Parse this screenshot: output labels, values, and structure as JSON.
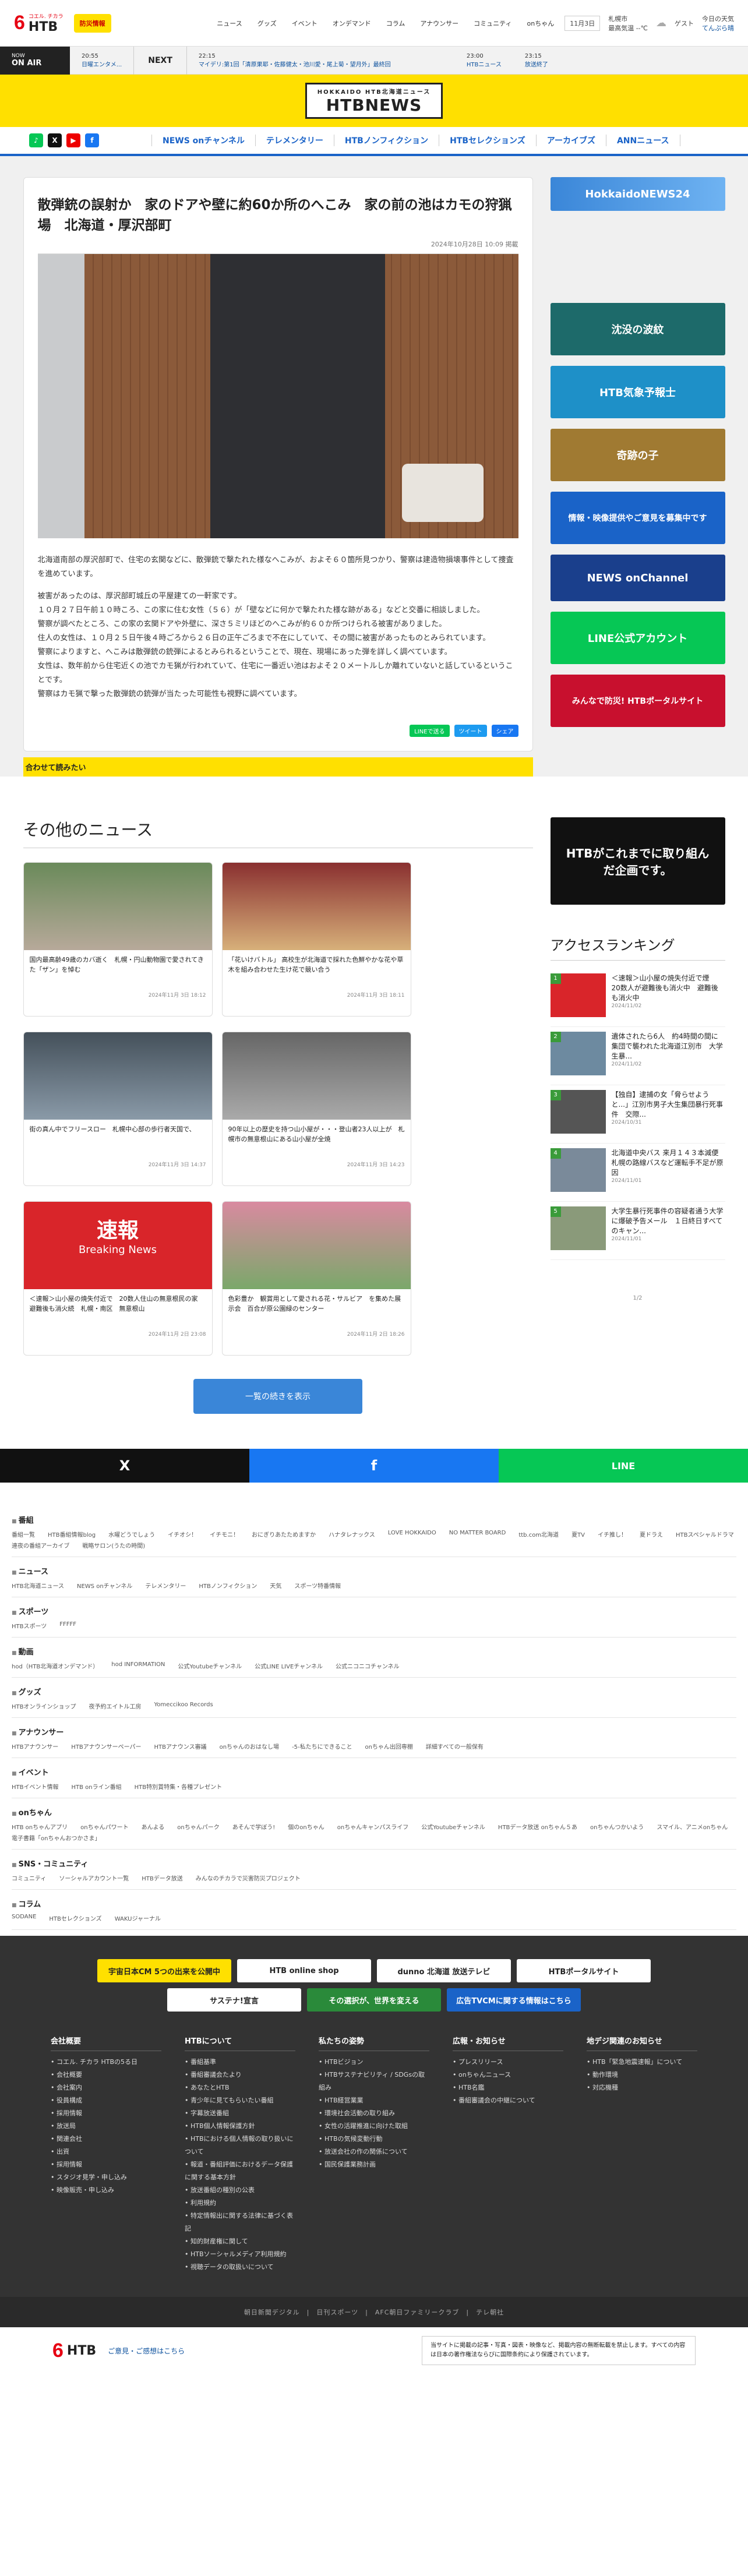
{
  "header": {
    "brand_six": "6",
    "brand_sub": "コエル. チカラ",
    "brand_htb": "HTB",
    "bosai": "防災情報",
    "nav": [
      "ニュース",
      "グッズ",
      "イベント",
      "オンデマンド",
      "コラム",
      "アナウンサー",
      "コミュニティ",
      "onちゃん"
    ],
    "date": "11月3日",
    "location": "札幌市",
    "weather_note": "最高気温 --℃",
    "today": "今日の天気",
    "today_val": "てんぷら晴",
    "user": "ゲスト"
  },
  "ticker": {
    "onair_sub": "NOW",
    "onair": "ON AIR",
    "now_time": "20:55",
    "now_prog": "日曜エンタメ...",
    "next": "NEXT",
    "items": [
      {
        "time": "22:15",
        "prog": "マイデリ:第1回「清原果耶・佐藤健太・池川愛・尾上菊・望月外」最終回"
      },
      {
        "time": "23:00",
        "prog": "HTBニュース"
      },
      {
        "time": "23:15",
        "prog": "放送終了"
      }
    ]
  },
  "masthead": {
    "top": "HOKKAIDO HTB北海道ニュース",
    "main": "HTBNEWS"
  },
  "nav": {
    "items": [
      "NEWS onチャンネル",
      "テレメンタリー",
      "HTBノンフィクション",
      "HTBセレクションズ",
      "アーカイブズ",
      "ANNニュース"
    ]
  },
  "article": {
    "title": "散弾銃の誤射か　家のドアや壁に約60か所のへこみ　家の前の池はカモの狩猟場　北海道・厚沢部町",
    "date": "2024年10月28日 10:09 掲載",
    "paragraphs": [
      "北海道南部の厚沢部町で、住宅の玄関などに、散弾銃で撃たれた様なへこみが、およそ６０箇所見つかり、警察は建造物損壊事件として捜査を進めています。",
      "被害があったのは、厚沢部町城丘の平屋建ての一軒家です。\n１０月２７日午前１０時ころ、この家に住む女性（５６）が「壁などに何かで撃たれた様な跡がある」などと交番に相談しました。\n警察が調べたところ、この家の玄関ドアや外壁に、深さ５ミリほどのへこみが約６０か所つけられる被害がありました。\n住人の女性は、１０月２５日午後４時ごろから２６日の正午ごろまで不在にしていて、その間に被害があったものとみられています。\n警察によりますと、へこみは散弾銃の銃弾によるとみられるということで、現在、現場にあった弾を詳しく調べています。\n女性は、数年前から住宅近くの池でカモ猟が行われていて、住宅に一番近い池はおよそ２０メートルしか離れていないと話しているということです。\n警察はカモ猟で撃った散弾銃の銃弾が当たった可能性も視野に調べています。"
    ],
    "share": [
      "LINEで送る",
      "ツイート",
      "シェア"
    ],
    "readtoo": "合わせて読みたい"
  },
  "sidebar": {
    "banners": [
      "HokkaidoNEWS24",
      "沈没の波紋",
      "HTB気象予報士",
      "奇跡の子",
      "情報・映像提供やご意見を募集中です",
      "NEWS onChannel",
      "LINE公式アカウント",
      "みんなで防災! HTBポータルサイト",
      "HTBがこれまでに取り組んだ企画です。"
    ]
  },
  "others": {
    "title": "その他のニュース",
    "cards": [
      {
        "t": "国内最高齢49歳のカバ逝く　札幌・円山動物園で愛されてきた「ザン」を悼む",
        "d": "2024年11月 3日 18:12"
      },
      {
        "t": "「花いけバトル」 高校生が北海道で採れた色鮮やかな花や草木を組み合わせた生け花で競い合う",
        "d": "2024年11月 3日 18:11"
      },
      {
        "t": "街の真ん中でフリースロー　札幌中心部の歩行者天国で、",
        "d": "2024年11月 3日 14:37"
      },
      {
        "t": "90年以上の歴史を持つ山小屋が・・・登山者23人以上が　札幌市の無意根山にある山小屋が全焼",
        "d": "2024年11月 3日 14:23"
      },
      {
        "t": "＜速報＞山小屋の焼失付近で　20数人住山の無意根民の家　避難後も消火続　札幌・南区　無意根山",
        "d": "2024年11月 2日 23:08"
      },
      {
        "t": "色彩豊か　観賞用として愛される花・サルビア　を集めた展示会　百合が原公園緑のセンター",
        "d": "2024年11月 2日 18:26"
      }
    ],
    "more": "一覧の続きを表示",
    "breaking_top": "速報",
    "breaking_bot": "Breaking News"
  },
  "ranking": {
    "title": "アクセスランキング",
    "items": [
      {
        "n": "1",
        "t": "＜速報＞山小屋の焼失付近で煙　20数人が避難後も消火中　避難後も消火中",
        "d": "2024/11/02"
      },
      {
        "n": "2",
        "t": "遺体されたら6人　約4時間の間に集団で襲われた北海道江別市　大学生暴...",
        "d": "2024/11/02"
      },
      {
        "n": "3",
        "t": "【独自】逮捕の女「脅らせようと...」江別市男子大生集団暴行死事件　交際...",
        "d": "2024/10/31"
      },
      {
        "n": "4",
        "t": "北海道中央バス 来月１４３本減便 札幌の路線バスなど運転手不足が原因",
        "d": "2024/11/01"
      },
      {
        "n": "5",
        "t": "大学生暴行死事件の容疑者通う大学に爆破予告メール　１日終日すべてのキャン...",
        "d": "2024/11/01"
      }
    ],
    "page": "1/2"
  },
  "sharebar": [
    "X",
    "f",
    "LINE"
  ],
  "sitemap": [
    {
      "t": "番組",
      "l": [
        "番組一覧",
        "HTB番組情報blog",
        "水曜どうでしょう",
        "イチオシ！",
        "イチモニ！",
        "おにぎりあたためますか",
        "ハナタレナックス",
        "LOVE HOKKAIDO",
        "NO MATTER BOARD",
        "ttb.com北海道",
        "夏TV",
        "イチ推し！",
        "夏ドラえ",
        "HTBスペシャルドラマ",
        "連夜の番組アーカイブ",
        "戦略サロン(うたの時間)"
      ]
    },
    {
      "t": "ニュース",
      "l": [
        "HTB北海道ニュース",
        "NEWS onチャンネル",
        "テレメンタリー",
        "HTBノンフィクション",
        "天気",
        "スポーツ特番情報"
      ]
    },
    {
      "t": "スポーツ",
      "l": [
        "HTBスポーツ",
        "FFFFF"
      ]
    },
    {
      "t": "動画",
      "l": [
        "hod（HTB北海道オンデマンド）",
        "hod INFORMATION",
        "公式Youtubeチャンネル",
        "公式LINE LIVEチャンネル",
        "公式ニコニコチャンネル"
      ]
    },
    {
      "t": "グッズ",
      "l": [
        "HTBオンラインショップ",
        "夜予約エイトル工房",
        "Yomeccikoo Records"
      ]
    },
    {
      "t": "アナウンサー",
      "l": [
        "HTBアナウンサー",
        "HTBアナウンサーペーパー",
        "HTBアナウンス審議",
        "onちゃんのおはなし場",
        "-5-私たちにできること",
        "onちゃん出回専棚",
        "詳細すべての一般保有"
      ]
    },
    {
      "t": "イベント",
      "l": [
        "HTBイベント情報",
        "HTB onライン番組",
        "HTB特別賞特集・各種プレゼント"
      ]
    },
    {
      "t": "onちゃん",
      "l": [
        "HTB onちゃんアプリ",
        "onちゃんパワート",
        "あんよる",
        "onちゃんパーク",
        "あそんで学ぼう!",
        "個のonちゃん",
        "onちゃんキャンパスライフ",
        "公式Youtubeチャンネル",
        "HTBデータ放送 onちゃん５あ",
        "onちゃんつかいよう",
        "スマイル、アニメonちゃん",
        "電子書籍「onちゃんおつかさま」"
      ]
    },
    {
      "t": "SNS・コミュニティ",
      "l": [
        "コミュニティ",
        "ソーシャルアカウント一覧",
        "HTBデータ放送",
        "みんなのチカラで災害防災プロジェクト"
      ]
    },
    {
      "t": "コラム",
      "l": [
        "SODANE",
        "HTBセレクションズ",
        "WAKUジャーナル"
      ]
    }
  ],
  "footerbanners": [
    "宇宙日本CM 5つの出来を公開中",
    "HTB online shop",
    "dunno 北海道 放送テレビ",
    "HTBポータルサイト",
    "サステナ!宣言",
    "その選択が、世界を変える",
    "広告TVCMに関する情報はこちら"
  ],
  "footer": [
    {
      "h": "会社概要",
      "l": [
        "コエル. チカラ HTBの5る日",
        "会社概要",
        "会社案内",
        "役員構成",
        "採用情報",
        "放送局",
        "関連会社",
        "出資",
        "採用情報",
        "スタジオ見学・申し込み",
        "映像販売・申し込み"
      ]
    },
    {
      "h": "HTBについて",
      "l": [
        "番組基準",
        "番組審議会たより",
        "あなたとHTB",
        "青少年に見てもらいたい番組",
        "字幕放送番組",
        "HTB個人情報保護方針",
        "HTBにおける個人情報の取り扱いについて",
        "報道・番組評価におけるデータ保護に関する基本方針",
        "放送番組の種別の公表",
        "利用規約",
        "特定情報出に関する法律に基づく表記",
        "知的財産権に関して",
        "HTBソーシャルメディア利用規約",
        "視聴データの取扱いについて"
      ]
    },
    {
      "h": "私たちの姿勢",
      "l": [
        "HTBビジョン",
        "HTBサステナビリティ / SDGsの取組み",
        "HTB経営業業",
        "環境社会活動の取り組み",
        "女性の活躍推進に向けた取組",
        "HTBの気候変動行動",
        "放送会社の作の関係について",
        "国民保護業務計画"
      ]
    },
    {
      "h": "広報・お知らせ",
      "l": [
        "プレスリリース",
        "onちゃんニュース",
        "HTB名鑑",
        "番組審議会の中継について"
      ]
    },
    {
      "h": "地デジ関連のお知らせ",
      "l": [
        "HTB「緊急地震速報」について",
        "動作環境",
        "対応機種"
      ]
    }
  ],
  "footerlinks": "朝日新聞デジタル　|　日刊スポーツ　|　AFC朝日ファミリークラブ　|　テレ朝社",
  "bottom": {
    "copy": "当サイトに掲載の記事・写真・図表・映像など、掲載内容の無断転載を禁止します。すべての内容は日本の著作権法ならびに国際条約により保護されています。",
    "contact": "ご意見・ご感想はこちら"
  },
  "colors": {
    "yellow": "#ffe000",
    "blue": "#1a63c8",
    "red": "#e60012"
  }
}
